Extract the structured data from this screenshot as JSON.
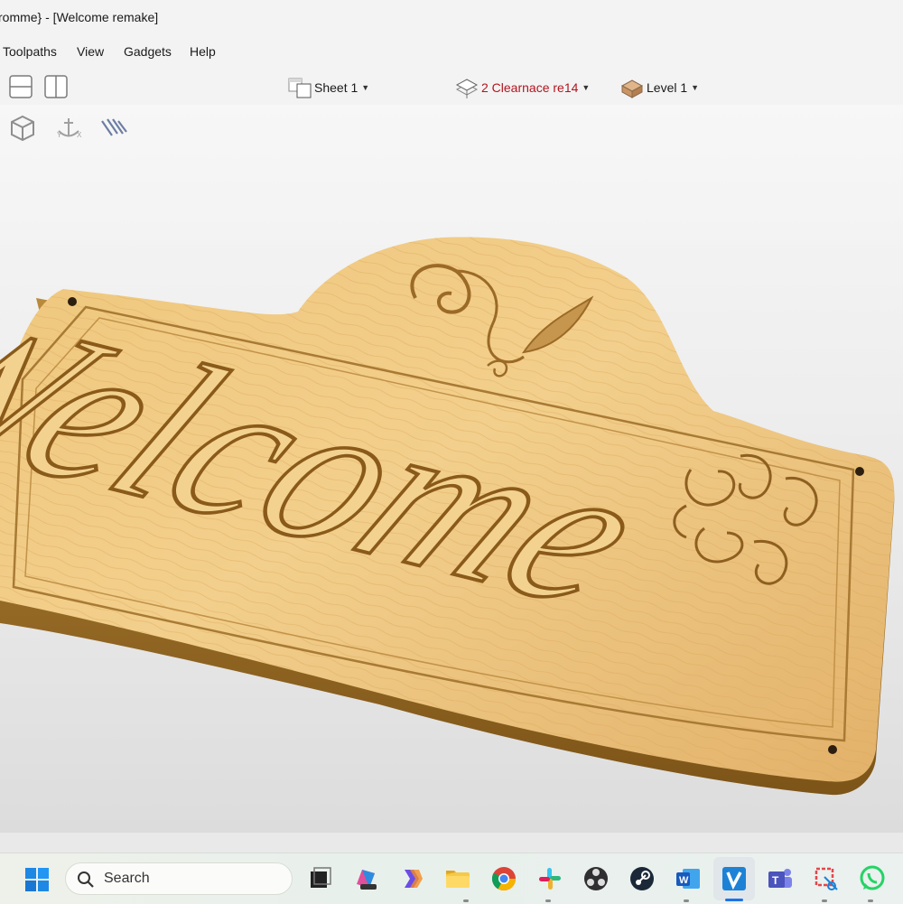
{
  "window": {
    "title": "romme} - [Welcome  remake]"
  },
  "menu": {
    "items": [
      "Toolpaths",
      "View",
      "Gadgets",
      "Help"
    ]
  },
  "toolbar": {
    "sheet_label": "Sheet 1",
    "toolpath_label": "2 Clearnace re14",
    "level_label": "Level 1",
    "toolpath_color": "#b4141e"
  },
  "viewport": {
    "background": "#ebebeb",
    "icons": [
      "cube-view-icon",
      "anchor-icon",
      "toolpath-preview-icon"
    ],
    "model": {
      "sign_text": "Welcome",
      "material_color": "#e8b86a",
      "edge_color": "#9c6a22"
    }
  },
  "taskbar": {
    "search_label": "Search",
    "apps": [
      "task-view",
      "m365",
      "copilot",
      "file-explorer",
      "chrome",
      "slack",
      "obs",
      "steam",
      "word",
      "vectric",
      "teams",
      "snipping-tool",
      "whatsapp"
    ],
    "accent": "#1a73e8"
  }
}
